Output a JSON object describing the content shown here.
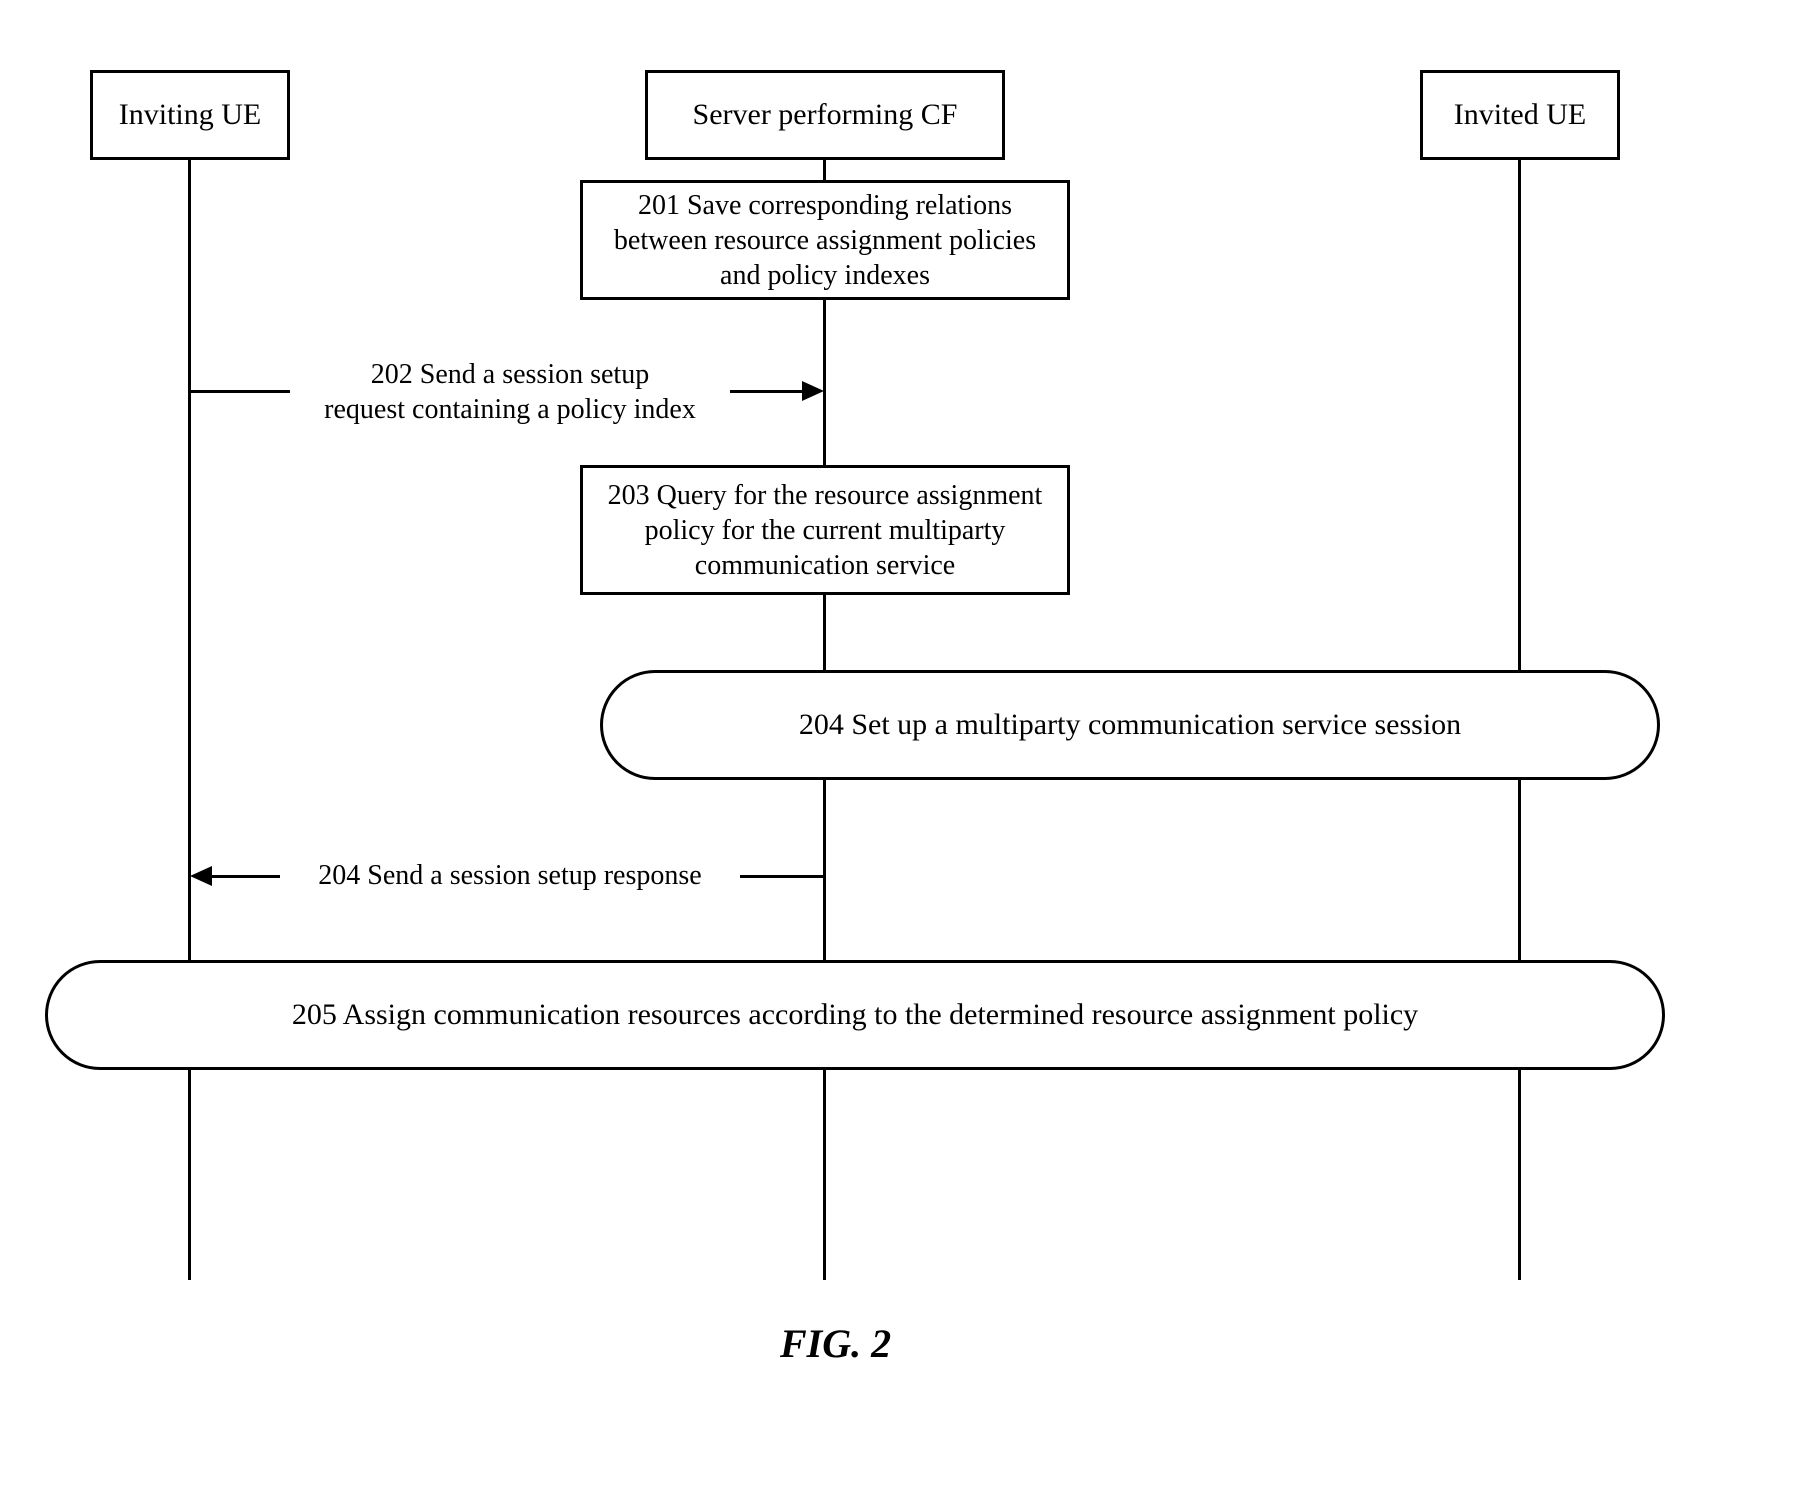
{
  "participants": {
    "inviting_ue": "Inviting UE",
    "server_cf": "Server performing CF",
    "invited_ue": "Invited UE"
  },
  "steps": {
    "s201": "201 Save corresponding relations between resource assignment policies and policy indexes",
    "s202_line1": "202 Send a session setup",
    "s202_line2": "request containing a policy index",
    "s203": "203 Query for the resource assignment policy for the current multiparty communication service",
    "s204_setup": "204 Set up a multiparty communication service session",
    "s204_response": "204 Send a session setup response",
    "s205": "205 Assign communication resources according to the determined resource assignment policy"
  },
  "caption": "FIG. 2"
}
